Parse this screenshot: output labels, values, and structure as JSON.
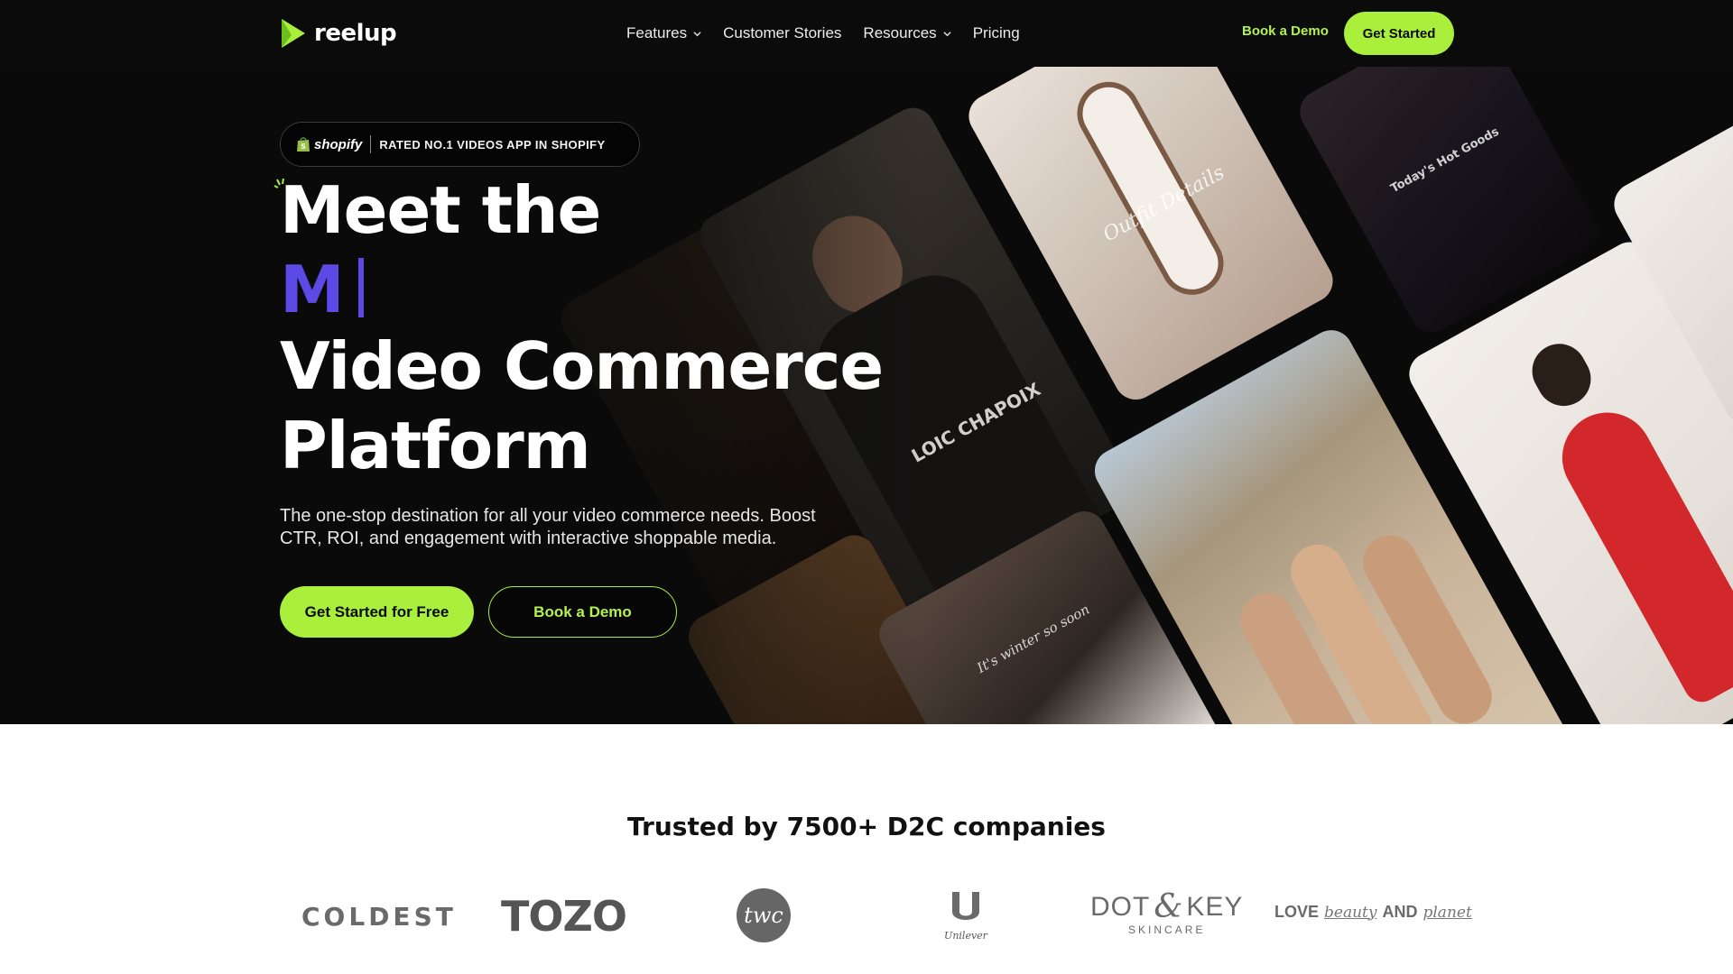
{
  "nav": {
    "brand": "reelup",
    "links": [
      {
        "label": "Features",
        "dropdown": true
      },
      {
        "label": "Customer Stories",
        "dropdown": false
      },
      {
        "label": "Resources",
        "dropdown": true
      },
      {
        "label": "Pricing",
        "dropdown": false
      }
    ],
    "book_demo": "Book a Demo",
    "get_started": "Get Started"
  },
  "hero": {
    "badge": {
      "shopify": "shopify",
      "text": "RATED NO.1 VIDEOS APP IN SHOPIFY"
    },
    "title_line1": "Meet the",
    "title_typed": "M",
    "title_line3": "Video Commerce",
    "title_line4": "Platform",
    "subtitle": "The one-stop destination for all your video commerce needs. Boost CTR, ROI, and engagement with interactive shoppable media.",
    "primary_cta": "Get Started for Free",
    "secondary_cta": "Book a Demo",
    "video_captions": [
      "Outfit Details",
      "Today's Hot Goods",
      "LOIC CHAPOIX",
      "It's winter so soon"
    ]
  },
  "trusted": {
    "heading": "Trusted by 7500+ D2C companies",
    "brands": {
      "coldest": "COLDEST",
      "tozo": "TOZO",
      "twc": "twc",
      "unilever": "Unilever",
      "dotkey_main_left": "DOT",
      "dotkey_amp": "&",
      "dotkey_main_right": "KEY",
      "dotkey_sub": "SKINCARE",
      "love_1": "LOVE",
      "love_2": "beauty",
      "love_3": "AND",
      "love_4": "planet"
    }
  },
  "colors": {
    "accent_green": "#a9ef3c",
    "accent_purple": "#5b4ae6",
    "hero_bg": "#0a0a0a"
  }
}
